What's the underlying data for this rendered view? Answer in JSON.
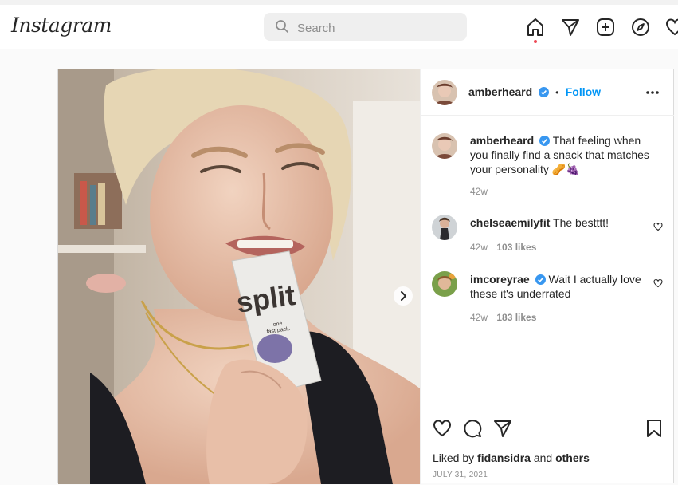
{
  "header": {
    "logo_text": "Instagram",
    "search_placeholder": "Search",
    "nav_icons": [
      "home-icon",
      "direct-icon",
      "new-post-icon",
      "explore-icon",
      "activity-icon"
    ],
    "active": "home"
  },
  "post": {
    "author": {
      "username": "amberheard",
      "verified": true
    },
    "follow_label": "Follow",
    "separator": "•",
    "more_icon": "more-options-icon",
    "image_text": {
      "brand": "split",
      "tag_line": "one\nfast pack."
    },
    "caption": {
      "username": "amberheard",
      "text": "That feeling when you finally find a snack that matches your personality 🥜🍇",
      "time": "42w"
    },
    "comments": [
      {
        "username": "chelseaemilyfit",
        "verified": false,
        "text": "The bestttt!",
        "time": "42w",
        "likes": "103 likes"
      },
      {
        "username": "imcoreyrae",
        "verified": true,
        "text": "Wait I actually love these it's underrated",
        "time": "42w",
        "likes": "183 likes"
      }
    ],
    "liked_by": {
      "prefix": "Liked by",
      "user": "fidansidra",
      "and": "and",
      "others": "others"
    },
    "date": "JULY 31, 2021"
  },
  "colors": {
    "accent": "#0095f6",
    "text": "#262626",
    "muted": "#8e8e8e",
    "border": "#dbdbdb",
    "notification": "#ed4956"
  }
}
